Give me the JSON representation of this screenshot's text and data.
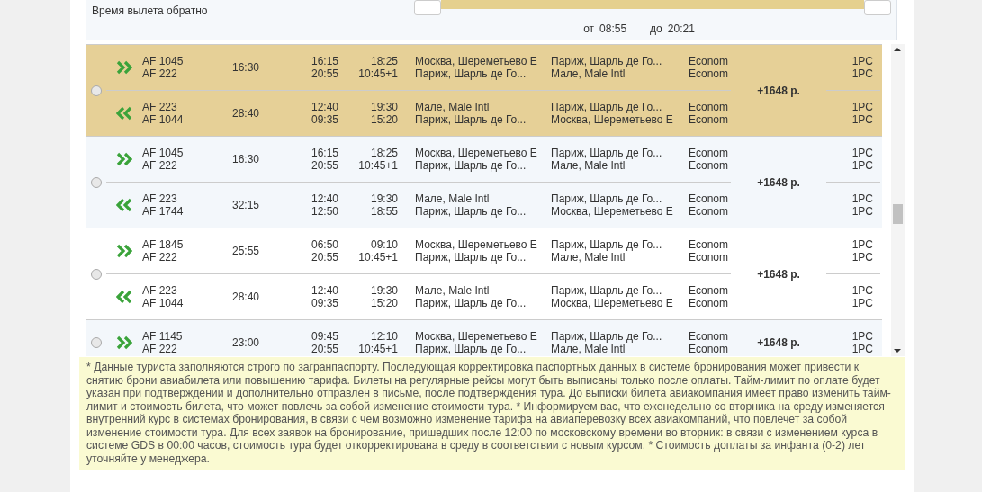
{
  "filter": {
    "label": "Время вылета обратно",
    "level": 1,
    "from_label": "от",
    "from_value": "08:55",
    "to_label": "до",
    "to_value": "20:21"
  },
  "options": [
    {
      "selected": true,
      "price": "+1648 р.",
      "legs": [
        {
          "kind": "outbound",
          "duration": "16:30",
          "segments": [
            {
              "flight": "AF 1045",
              "dep": "16:15",
              "arr": "18:25",
              "from": "Москва, Шереметьево E",
              "to": "Париж, Шарль де Го...",
              "class": "Econom",
              "baggage": "1PC"
            },
            {
              "flight": "AF 222",
              "dep": "20:55",
              "arr": "10:45+1",
              "from": "Париж, Шарль де Го...",
              "to": "Мале, Male Intl",
              "class": "Econom",
              "baggage": "1PC"
            }
          ]
        },
        {
          "kind": "return",
          "duration": "28:40",
          "segments": [
            {
              "flight": "AF 223",
              "dep": "12:40",
              "arr": "19:30",
              "from": "Мале, Male Intl",
              "to": "Париж, Шарль де Го...",
              "class": "Econom",
              "baggage": "1PC"
            },
            {
              "flight": "AF 1044",
              "dep": "09:35",
              "arr": "15:20",
              "from": "Париж, Шарль де Го...",
              "to": "Москва, Шереметьево E",
              "class": "Econom",
              "baggage": "1PC"
            }
          ]
        }
      ]
    },
    {
      "selected": false,
      "price": "+1648 р.",
      "legs": [
        {
          "kind": "outbound",
          "duration": "16:30",
          "segments": [
            {
              "flight": "AF 1045",
              "dep": "16:15",
              "arr": "18:25",
              "from": "Москва, Шереметьево E",
              "to": "Париж, Шарль де Го...",
              "class": "Econom",
              "baggage": "1PC"
            },
            {
              "flight": "AF 222",
              "dep": "20:55",
              "arr": "10:45+1",
              "from": "Париж, Шарль де Го...",
              "to": "Мале, Male Intl",
              "class": "Econom",
              "baggage": "1PC"
            }
          ]
        },
        {
          "kind": "return",
          "duration": "32:15",
          "segments": [
            {
              "flight": "AF 223",
              "dep": "12:40",
              "arr": "19:30",
              "from": "Мале, Male Intl",
              "to": "Париж, Шарль де Го...",
              "class": "Econom",
              "baggage": "1PC"
            },
            {
              "flight": "AF 1744",
              "dep": "12:50",
              "arr": "18:55",
              "from": "Париж, Шарль де Го...",
              "to": "Москва, Шереметьево E",
              "class": "Econom",
              "baggage": "1PC"
            }
          ]
        }
      ]
    },
    {
      "selected": false,
      "price": "+1648 р.",
      "legs": [
        {
          "kind": "outbound",
          "duration": "25:55",
          "segments": [
            {
              "flight": "AF 1845",
              "dep": "06:50",
              "arr": "09:10",
              "from": "Москва, Шереметьево E",
              "to": "Париж, Шарль де Го...",
              "class": "Econom",
              "baggage": "1PC"
            },
            {
              "flight": "AF 222",
              "dep": "20:55",
              "arr": "10:45+1",
              "from": "Париж, Шарль де Го...",
              "to": "Мале, Male Intl",
              "class": "Econom",
              "baggage": "1PC"
            }
          ]
        },
        {
          "kind": "return",
          "duration": "28:40",
          "segments": [
            {
              "flight": "AF 223",
              "dep": "12:40",
              "arr": "19:30",
              "from": "Мале, Male Intl",
              "to": "Париж, Шарль де Го...",
              "class": "Econom",
              "baggage": "1PC"
            },
            {
              "flight": "AF 1044",
              "dep": "09:35",
              "arr": "15:20",
              "from": "Париж, Шарль де Го...",
              "to": "Москва, Шереметьево E",
              "class": "Econom",
              "baggage": "1PC"
            }
          ]
        }
      ]
    },
    {
      "selected": false,
      "price": "+1648 р.",
      "legs": [
        {
          "kind": "outbound",
          "duration": "23:00",
          "segments": [
            {
              "flight": "AF 1145",
              "dep": "09:45",
              "arr": "12:10",
              "from": "Москва, Шереметьево E",
              "to": "Париж, Шарль де Го...",
              "class": "Econom",
              "baggage": "1PC"
            },
            {
              "flight": "AF 222",
              "dep": "20:55",
              "arr": "10:45+1",
              "from": "Париж, Шарль де Го...",
              "to": "Мале, Male Intl",
              "class": "Econom",
              "baggage": "1PC"
            }
          ]
        }
      ]
    }
  ],
  "notes": "* Данные туриста заполняются строго по загранпаспорту. Последующая корректировка паспортных данных в системе бронирования может привести к снятию брони авиабилета или повышению тарифа. Билеты на регулярные рейсы могут быть выписаны только после оплаты. Тайм-лимит по оплате будет указан при подтверждении и дополнительно отправлен в письме, после подтверждения тура. До выписки билета авиакомпания имеет право изменить тайм-лимит и стоимость билета, что может повлечь за собой изменение стоимости тура. * Информируем вас, что еженедельно со вторника на среду изменяется внутренний курс в системах бронирования, в связи с чем возможно изменение тарифа на авиаперевозку всех авиакомпаний, что повлечет за собой изменение стоимости тура. Для всех заявок на бронирование, пришедших после 12:00 по московскому времени во вторник: в связи с изменением курса в системе GDS в 00:00 часов, стоимость тура будет откорректирована в среду в соответствии с новым курсом. * Стоимость доплаты за инфанта (0-2) лет уточняйте у менеджера."
}
